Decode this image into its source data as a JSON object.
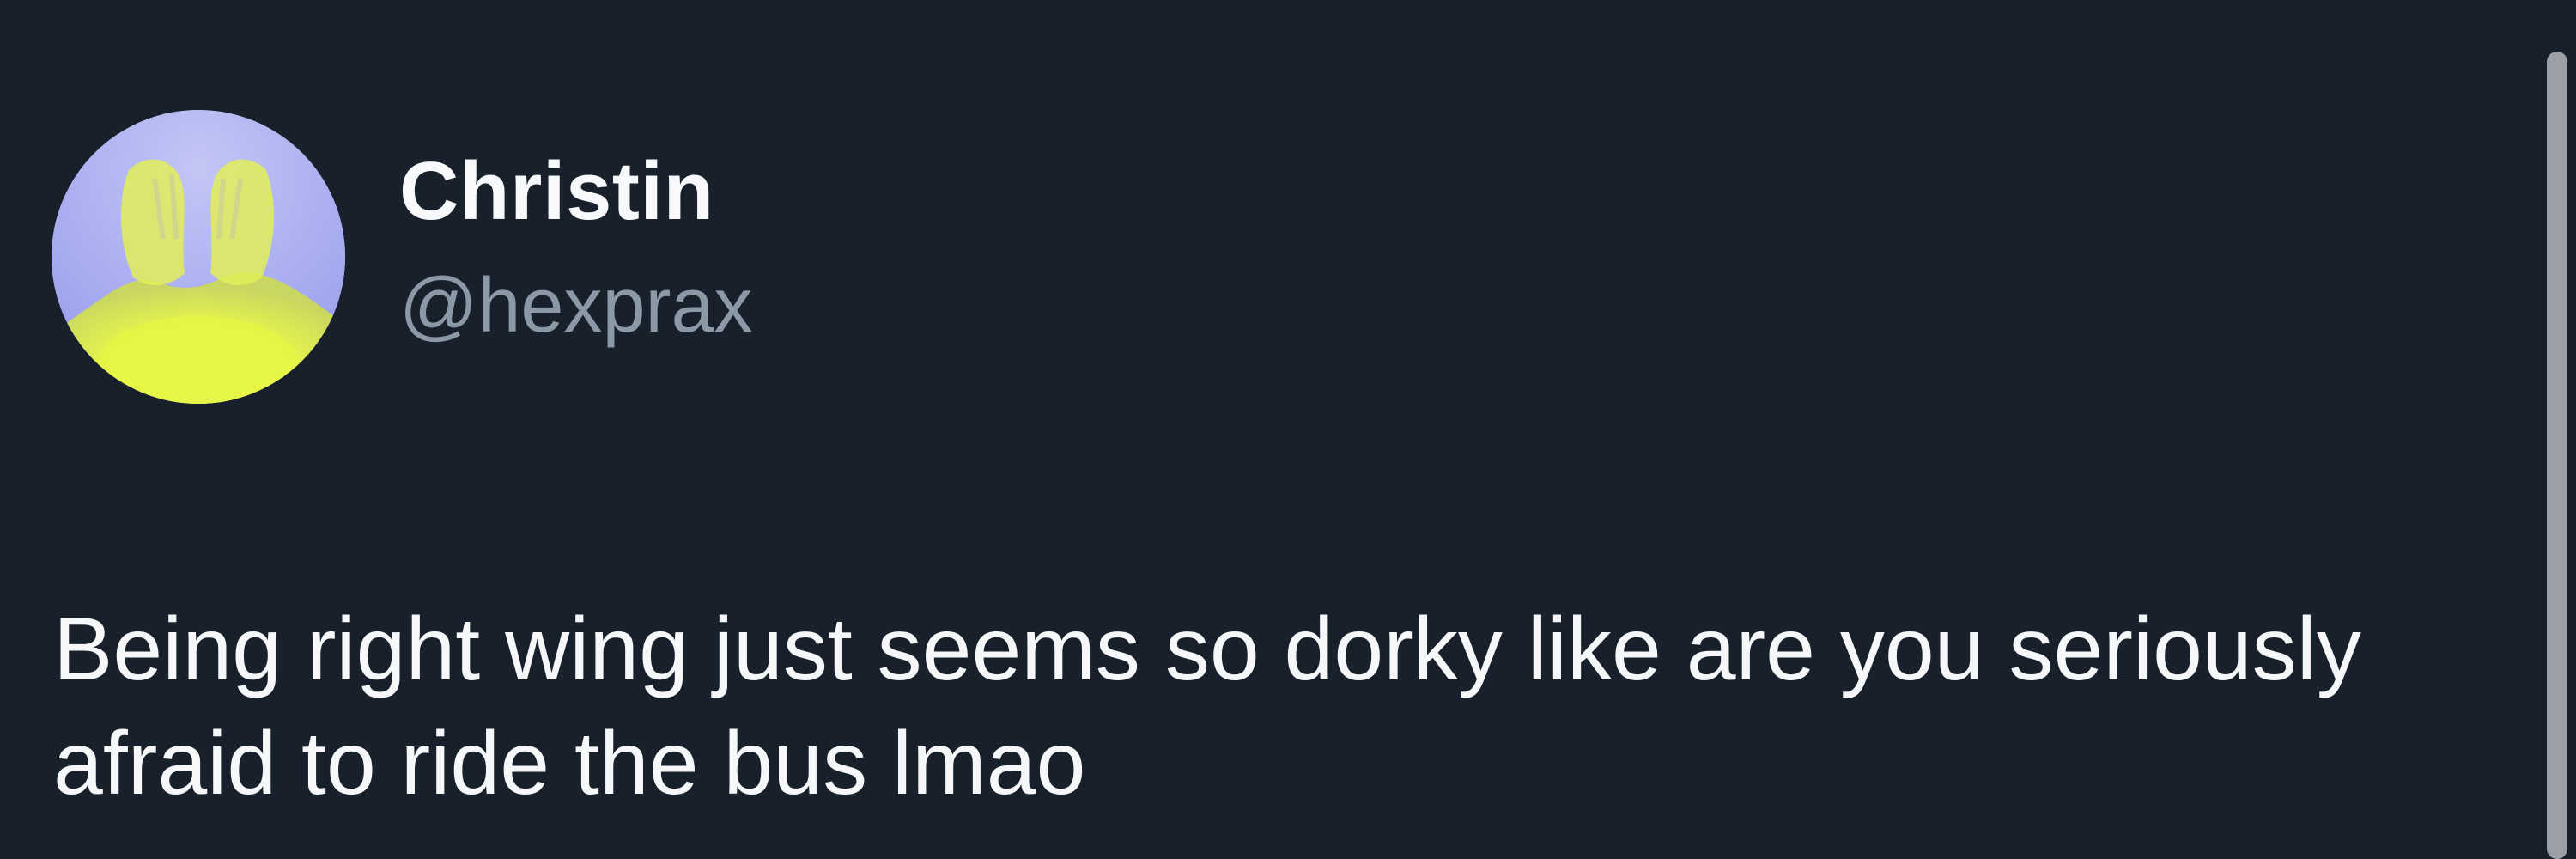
{
  "tweet": {
    "author": {
      "display_name": "Christin",
      "handle": "@hexprax",
      "avatar_icon": "hands-over-face-avatar"
    },
    "text": "Being right wing just seems so dorky like are you seriously afraid to ride the bus lmao"
  },
  "colors": {
    "background": "#17202b",
    "text_primary": "#f5f7f9",
    "text_secondary": "#8b98a5",
    "avatar_yellow": "#e6f545",
    "avatar_lavender": "#a7a9ef"
  }
}
